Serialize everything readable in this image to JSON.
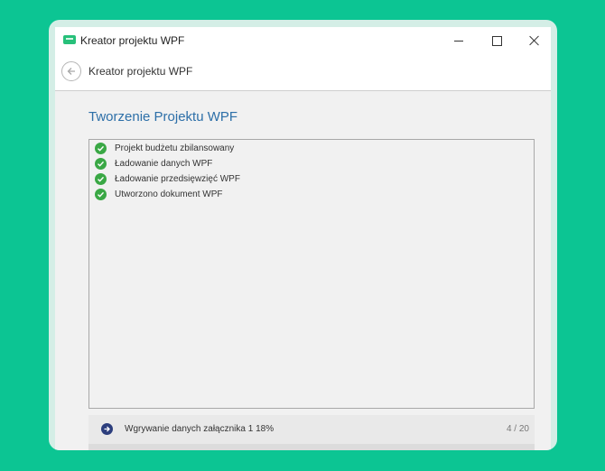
{
  "window": {
    "title": "Kreator projektu WPF",
    "accent_color": "#27c07a"
  },
  "nav": {
    "title": "Kreator projektu WPF"
  },
  "page": {
    "title": "Tworzenie Projektu WPF",
    "title_color": "#2d6fa8"
  },
  "tasks": [
    {
      "label": "Projekt budżetu zbilansowany",
      "status": "done",
      "icon": "check-icon"
    },
    {
      "label": "Ładowanie danych WPF",
      "status": "done",
      "icon": "check-icon"
    },
    {
      "label": "Ładowanie przedsięwzięć WPF",
      "status": "done",
      "icon": "check-icon"
    },
    {
      "label": "Utworzono dokument WPF",
      "status": "done",
      "icon": "check-icon"
    }
  ],
  "status": {
    "icon": "arrow-right-icon",
    "text": "Wgrywanie danych załącznika 1 18%",
    "count": "4 / 20"
  },
  "colors": {
    "background": "#0cc593",
    "check": "#3aa845",
    "status_icon": "#2c3e7d"
  }
}
